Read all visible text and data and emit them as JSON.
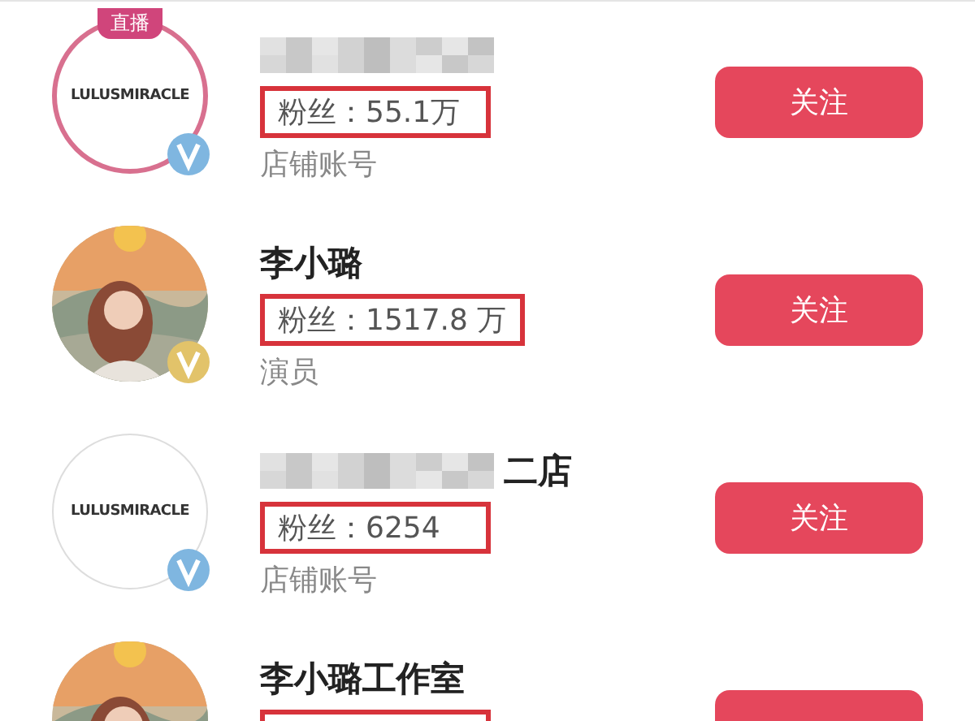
{
  "accounts": [
    {
      "avatar": {
        "kind": "live_logo",
        "badge": "直播",
        "logo": "LULUSMIRACLE"
      },
      "color": "#7fb6e0",
      "name": {
        "blurred": true
      },
      "highlighted": true,
      "fans": "粉丝：55.1万",
      "subtitle": "店铺账号",
      "button_label": "关注"
    },
    {
      "color": "#e2c36a",
      "name": {
        "blurred": false,
        "text": "李小璐"
      },
      "highlighted": true,
      "fans": "粉丝：1517.8 万",
      "subtitle": "演员",
      "button_label": "关注"
    },
    {
      "avatar": {
        "kind": "logo",
        "logo": "LULUSMIRACLE"
      },
      "color": "#7fb6e0",
      "name": {
        "blurred": true,
        "suffix": "二店"
      },
      "highlighted": true,
      "fans": "粉丝：6254",
      "subtitle": "店铺账号",
      "button_label": "关注"
    },
    {
      "name": {
        "blurred": false,
        "text": "李小璐工作室"
      },
      "highlighted": true
    }
  ]
}
